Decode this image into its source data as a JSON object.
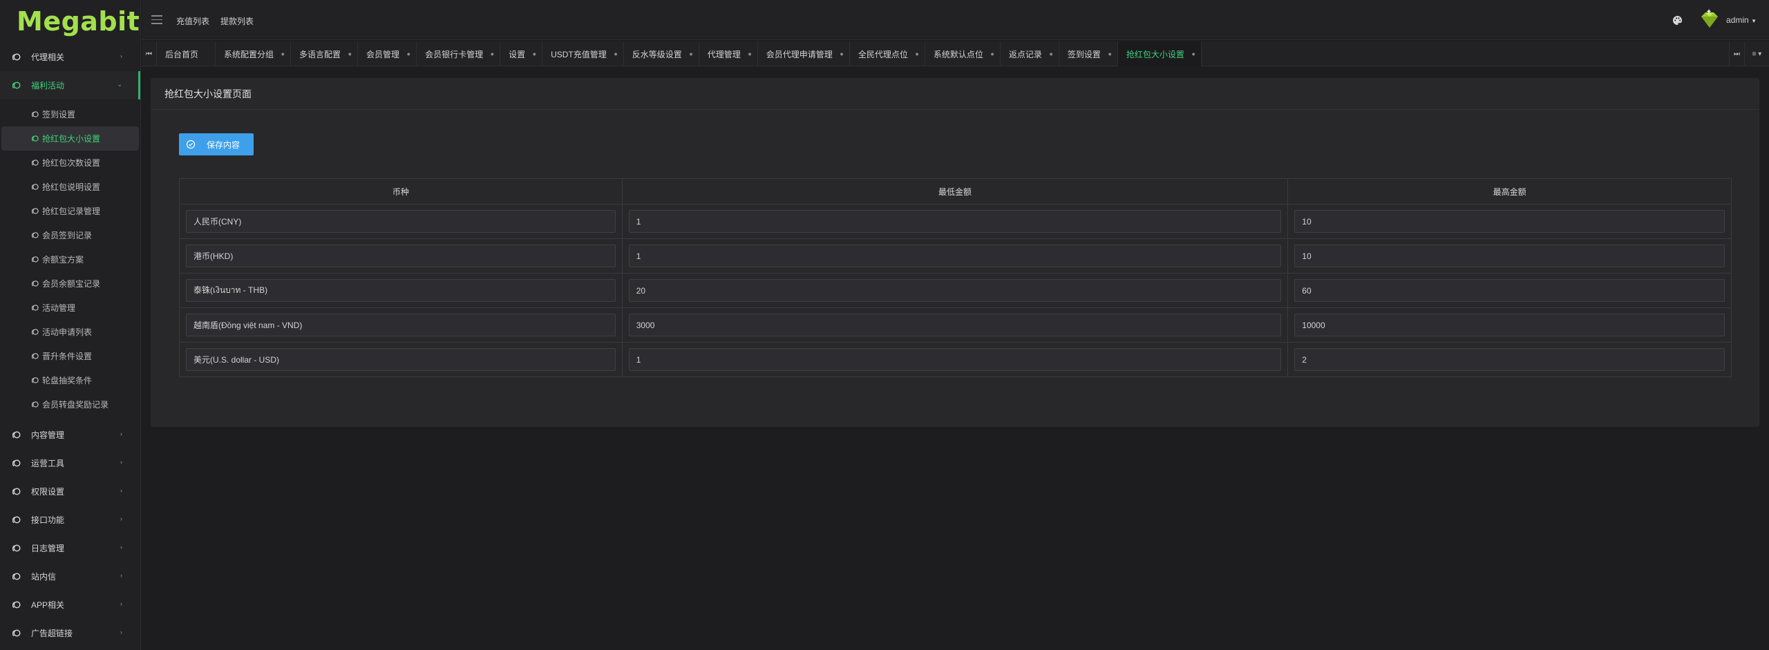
{
  "app": {
    "logo": "Megabit"
  },
  "sidebar": {
    "groups": [
      {
        "label": "代理相关",
        "active": false
      },
      {
        "label": "福利活动",
        "active": true,
        "items": [
          {
            "label": "签到设置",
            "active": false
          },
          {
            "label": "抢红包大小设置",
            "active": true
          },
          {
            "label": "抢红包次数设置",
            "active": false
          },
          {
            "label": "抢红包说明设置",
            "active": false
          },
          {
            "label": "抢红包记录管理",
            "active": false
          },
          {
            "label": "会员签到记录",
            "active": false
          },
          {
            "label": "余额宝方案",
            "active": false
          },
          {
            "label": "会员余额宝记录",
            "active": false
          },
          {
            "label": "活动管理",
            "active": false
          },
          {
            "label": "活动申请列表",
            "active": false
          },
          {
            "label": "晋升条件设置",
            "active": false
          },
          {
            "label": "轮盘抽奖条件",
            "active": false
          },
          {
            "label": "会员转盘奖励记录",
            "active": false
          }
        ]
      },
      {
        "label": "内容管理",
        "active": false
      },
      {
        "label": "运营工具",
        "active": false
      },
      {
        "label": "权限设置",
        "active": false
      },
      {
        "label": "接口功能",
        "active": false
      },
      {
        "label": "日志管理",
        "active": false
      },
      {
        "label": "站内信",
        "active": false
      },
      {
        "label": "APP相关",
        "active": false
      },
      {
        "label": "广告超链接",
        "active": false
      }
    ]
  },
  "header": {
    "links": [
      "充值列表",
      "提款列表"
    ],
    "user": "admin"
  },
  "tabs": [
    {
      "label": "后台首页",
      "active": false,
      "closable": false
    },
    {
      "label": "系统配置分组",
      "active": false,
      "closable": true
    },
    {
      "label": "多语言配置",
      "active": false,
      "closable": true
    },
    {
      "label": "会员管理",
      "active": false,
      "closable": true
    },
    {
      "label": "会员银行卡管理",
      "active": false,
      "closable": true
    },
    {
      "label": "设置",
      "active": false,
      "closable": true
    },
    {
      "label": "USDT充值管理",
      "active": false,
      "closable": true
    },
    {
      "label": "反水等级设置",
      "active": false,
      "closable": true
    },
    {
      "label": "代理管理",
      "active": false,
      "closable": true
    },
    {
      "label": "会员代理申请管理",
      "active": false,
      "closable": true
    },
    {
      "label": "全民代理点位",
      "active": false,
      "closable": true
    },
    {
      "label": "系统默认点位",
      "active": false,
      "closable": true
    },
    {
      "label": "返点记录",
      "active": false,
      "closable": true
    },
    {
      "label": "签到设置",
      "active": false,
      "closable": true
    },
    {
      "label": "抢红包大小设置",
      "active": true,
      "closable": true
    }
  ],
  "page": {
    "title": "抢红包大小设置页面",
    "save_label": "保存内容",
    "table": {
      "headers": [
        "币种",
        "最低金额",
        "最高金额"
      ],
      "rows": [
        {
          "currency": "人民币(CNY)",
          "min": "1",
          "max": "10"
        },
        {
          "currency": "港币(HKD)",
          "min": "1",
          "max": "10"
        },
        {
          "currency": "泰铢(เงินบาท - THB)",
          "min": "20",
          "max": "60"
        },
        {
          "currency": "越南盾(Đồng việt nam - VND)",
          "min": "3000",
          "max": "10000"
        },
        {
          "currency": "美元(U.S. dollar - USD)",
          "min": "1",
          "max": "2"
        }
      ]
    }
  },
  "colors": {
    "accent": "#3fd17a",
    "button": "#3ea0ea",
    "logo": "#a3e04e"
  }
}
